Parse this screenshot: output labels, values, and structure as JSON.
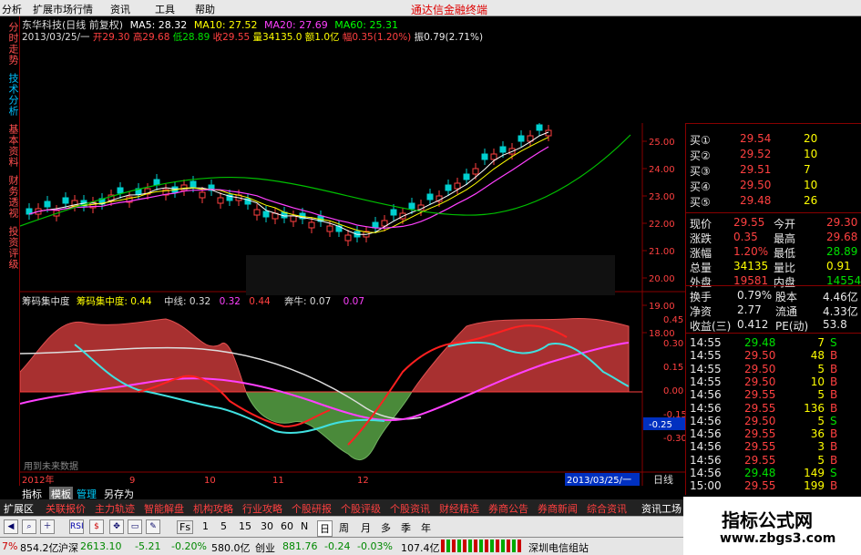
{
  "menu": {
    "items": [
      "分析",
      "扩展市场行情",
      "资讯",
      "工具",
      "帮助"
    ],
    "brand": "通达信金融终端"
  },
  "sidebar": {
    "tabs": [
      "分时走势",
      "技术分析",
      "基本资料",
      "财务透视",
      "投资评级"
    ]
  },
  "chart": {
    "title": "东华科技(日线 前复权)",
    "ma": [
      {
        "label": "MA5: 28.32",
        "color": "#ffffff"
      },
      {
        "label": "MA10: 27.52",
        "color": "#ffff00"
      },
      {
        "label": "MA20: 27.69",
        "color": "#ff40ff"
      },
      {
        "label": "MA60: 25.31",
        "color": "#00ff00"
      }
    ],
    "info_date": "2013/03/25/一",
    "info_open": "开29.30",
    "info_high": "高29.68",
    "info_low": "低28.89",
    "info_close": "收29.55",
    "info_vol": "量34135.0",
    "info_amt": "额1.0亿",
    "info_chg": "幅0.35(1.20%)",
    "info_amp": "振0.79(2.71%)",
    "price_axis": [
      "25.00",
      "24.00",
      "23.00",
      "22.00",
      "21.00",
      "20.00",
      "19.00",
      "18.00"
    ],
    "indicator_name": "筹码集中度",
    "indicator_legend": [
      {
        "label": "筹码集中度: 0.44",
        "color": "#ffff00"
      },
      {
        "label": "中线: 0.32",
        "color": "#dddddd"
      },
      {
        "label": "0.32",
        "color": "#ff40ff"
      },
      {
        "label": "0.44",
        "color": "#ff4040"
      },
      {
        "label": "奔牛: 0.07",
        "color": "#dddddd"
      },
      {
        "label": "0.07",
        "color": "#ff40ff"
      }
    ],
    "ind_axis": [
      "0.45",
      "0.30",
      "0.15",
      "0.00",
      "-0.15",
      "-0.30"
    ],
    "ind_current": "-0.25",
    "ind_watermark": "用到未来数据",
    "x_labels": [
      "2012年",
      "9",
      "10",
      "11",
      "12"
    ],
    "x_current": "2013/03/25/一",
    "period": "日线"
  },
  "quote": {
    "bids": [
      {
        "label": "买①",
        "price": "29.54",
        "vol": "20"
      },
      {
        "label": "买②",
        "price": "29.52",
        "vol": "10"
      },
      {
        "label": "买③",
        "price": "29.51",
        "vol": "7"
      },
      {
        "label": "买④",
        "price": "29.50",
        "vol": "10"
      },
      {
        "label": "买⑤",
        "price": "29.48",
        "vol": "26"
      }
    ],
    "stats": [
      {
        "l1": "现价",
        "v1": "29.55",
        "l2": "今开",
        "v2": "29.30",
        "c1": "red",
        "c2": "red"
      },
      {
        "l1": "涨跌",
        "v1": "0.35",
        "l2": "最高",
        "v2": "29.68",
        "c1": "red",
        "c2": "red"
      },
      {
        "l1": "涨幅",
        "v1": "1.20%",
        "l2": "最低",
        "v2": "28.89",
        "c1": "red",
        "c2": "green"
      },
      {
        "l1": "总量",
        "v1": "34135",
        "l2": "量比",
        "v2": "0.91",
        "c1": "yellow",
        "c2": "yellow"
      },
      {
        "l1": "外盘",
        "v1": "19581",
        "l2": "内盘",
        "v2": "14554",
        "c1": "red",
        "c2": "green"
      }
    ],
    "fund": [
      {
        "l1": "换手",
        "v1": "0.79%",
        "l2": "股本",
        "v2": "4.46亿"
      },
      {
        "l1": "净资",
        "v1": "2.77",
        "l2": "流通",
        "v2": "4.33亿"
      },
      {
        "l1": "收益(三)",
        "v1": "0.412",
        "l2": "PE(动)",
        "v2": "53.8"
      }
    ],
    "ticks": [
      {
        "t": "14:55",
        "p": "29.48",
        "v": "7",
        "d": "S"
      },
      {
        "t": "14:55",
        "p": "29.50",
        "v": "48",
        "d": "B"
      },
      {
        "t": "14:55",
        "p": "29.50",
        "v": "5",
        "d": "B"
      },
      {
        "t": "14:55",
        "p": "29.50",
        "v": "10",
        "d": "B"
      },
      {
        "t": "14:56",
        "p": "29.55",
        "v": "5",
        "d": "B"
      },
      {
        "t": "14:56",
        "p": "29.55",
        "v": "136",
        "d": "B"
      },
      {
        "t": "14:56",
        "p": "29.50",
        "v": "5",
        "d": "S"
      },
      {
        "t": "14:56",
        "p": "29.55",
        "v": "36",
        "d": "B"
      },
      {
        "t": "14:56",
        "p": "29.55",
        "v": "3",
        "d": "B"
      },
      {
        "t": "14:56",
        "p": "29.55",
        "v": "5",
        "d": "B"
      },
      {
        "t": "14:56",
        "p": "29.48",
        "v": "149",
        "d": "S"
      },
      {
        "t": "15:00",
        "p": "29.55",
        "v": "199",
        "d": "B"
      }
    ]
  },
  "tabs": {
    "items": [
      "指标",
      "模板",
      "管理",
      "另存为"
    ]
  },
  "nav2": {
    "items": [
      "扩展区",
      "关联报价",
      "主力轨迹",
      "智能解盘",
      "机构攻略",
      "行业攻略",
      "个股研报",
      "个股评级",
      "个股资讯",
      "财经精选",
      "券商公告",
      "券商新闻",
      "综合资讯",
      "资讯工场"
    ]
  },
  "toolbar": {
    "periods": [
      "Fs",
      "1",
      "5",
      "15",
      "30",
      "60",
      "N",
      "日",
      "周",
      "月",
      "多",
      "季",
      "年"
    ],
    "icons": [
      "RSI",
      "$"
    ]
  },
  "status": {
    "pct": "7%",
    "amt1": "854.2亿",
    "sh_label": "沪深",
    "sh_val": "2613.10",
    "sh_chg": "-5.21",
    "sh_pct": "-0.20%",
    "sh_amt": "580.0亿",
    "cy_label": "创业",
    "cy_val": "881.76",
    "cy_chg": "-0.24",
    "cy_pct": "-0.03%",
    "cy_amt": "107.4亿",
    "server": "深圳电信组站"
  },
  "watermark": {
    "title": "指标公式网",
    "url": "www.zbgs3.com"
  }
}
